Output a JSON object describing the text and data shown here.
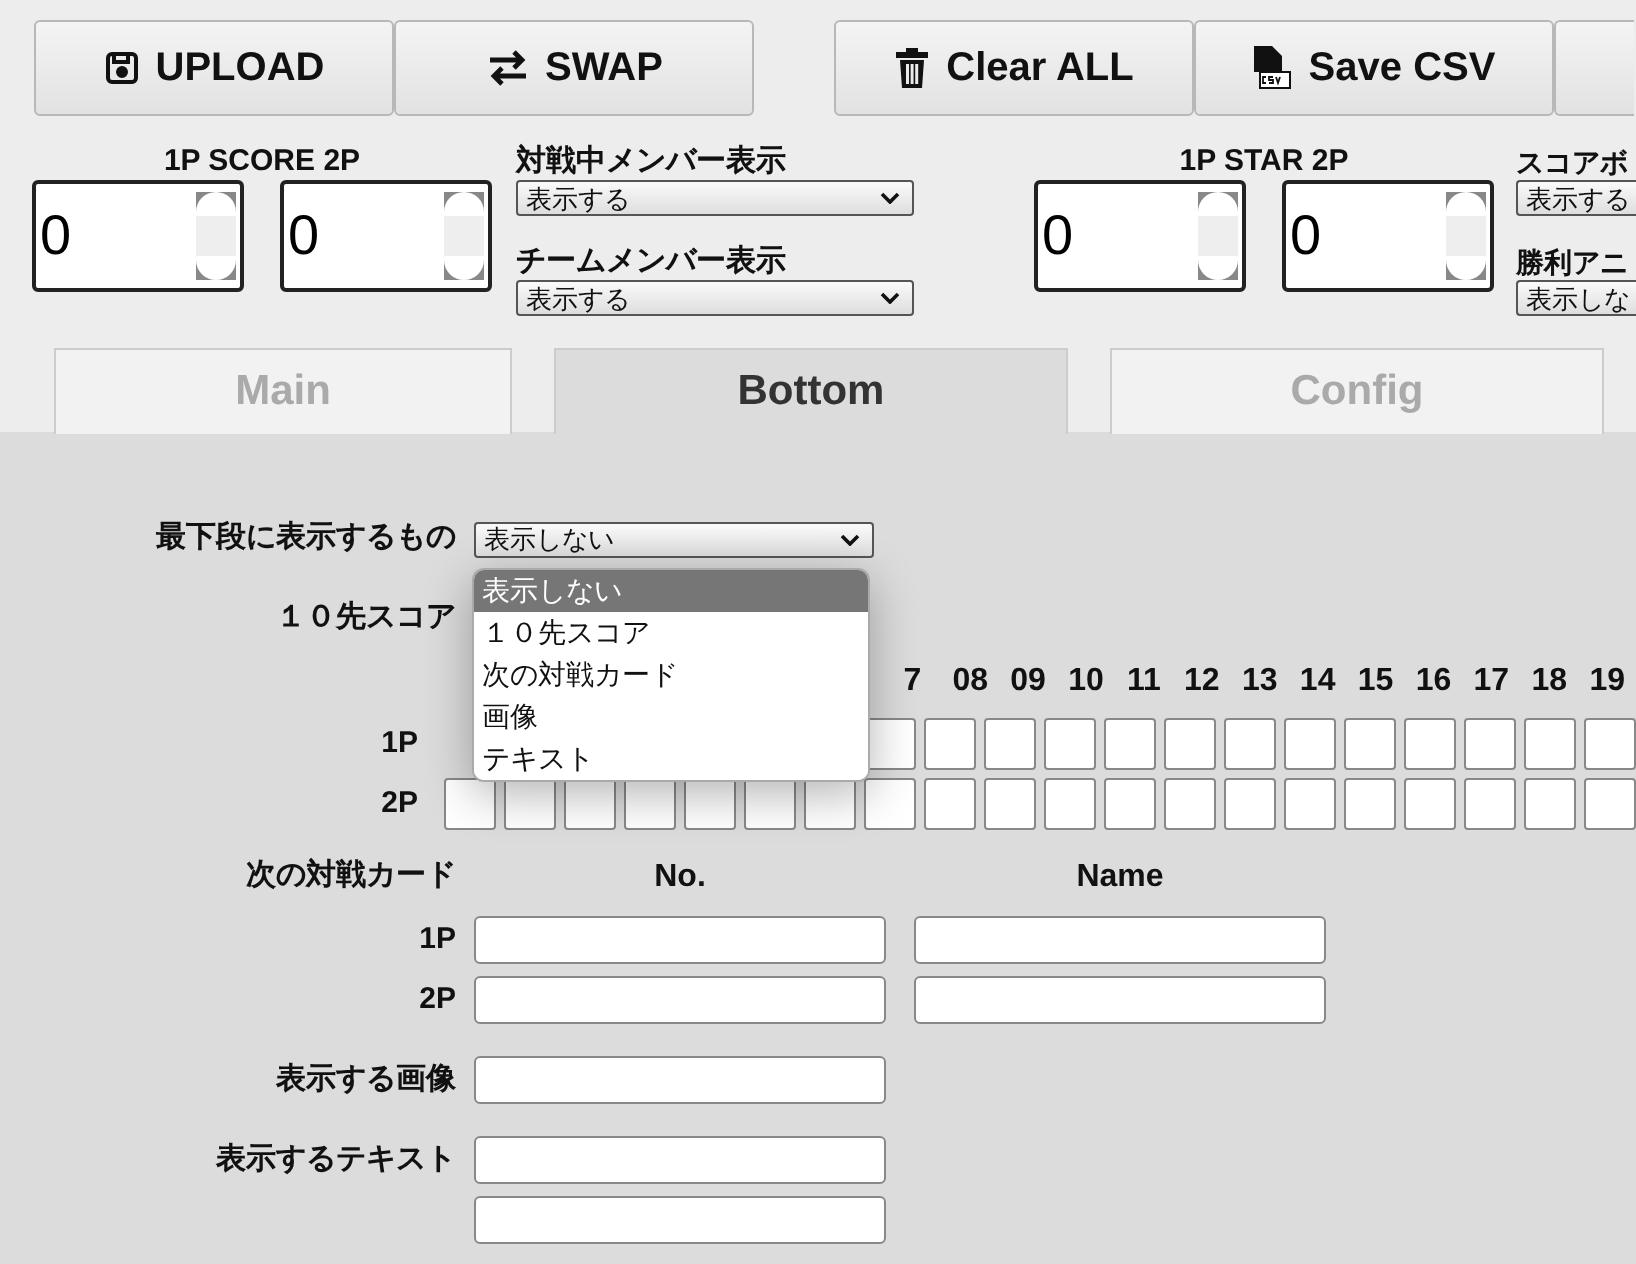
{
  "toolbar": {
    "buttons": [
      {
        "label": "UPLOAD"
      },
      {
        "label": "SWAP"
      },
      {
        "label": "Clear ALL"
      },
      {
        "label": "Save CSV"
      }
    ]
  },
  "score": {
    "label": "1P SCORE 2P",
    "values": [
      "0",
      "0"
    ]
  },
  "member_selects": [
    {
      "label": "対戦中メンバー表示",
      "value": "表示する"
    },
    {
      "label": "チームメンバー表示",
      "value": "表示する"
    }
  ],
  "star": {
    "label": "1P STAR 2P",
    "values": [
      "0",
      "0"
    ]
  },
  "right_selects": [
    {
      "label": "スコアボ",
      "value": "表示する"
    },
    {
      "label": "勝利アニ",
      "value": "表示しな"
    }
  ],
  "tabs": [
    {
      "label": "Main",
      "selected": false
    },
    {
      "label": "Bottom",
      "selected": true
    },
    {
      "label": "Config",
      "selected": false
    }
  ],
  "bottom": {
    "label": "最下段に表示するもの",
    "value": "表示しない",
    "expanded": true,
    "options": [
      {
        "label": "表示しない",
        "selected": true
      },
      {
        "label": "１０先スコア",
        "selected": false
      },
      {
        "label": "次の対戦カード",
        "selected": false
      },
      {
        "label": "画像",
        "selected": false
      },
      {
        "label": "テキスト",
        "selected": false
      }
    ]
  },
  "ten_score": {
    "label": "１０先スコア",
    "headers": [
      "7",
      "08",
      "09",
      "10",
      "11",
      "12",
      "13",
      "14",
      "15",
      "16",
      "17",
      "18",
      "19"
    ],
    "rows": [
      {
        "label": "1P"
      },
      {
        "label": "2P"
      }
    ]
  },
  "next_card": {
    "label": "次の対戦カード",
    "columns": [
      "No.",
      "Name"
    ],
    "rows": [
      {
        "label": "1P"
      },
      {
        "label": "2P"
      }
    ]
  },
  "image": {
    "label": "表示する画像"
  },
  "text": {
    "label": "表示するテキスト"
  }
}
